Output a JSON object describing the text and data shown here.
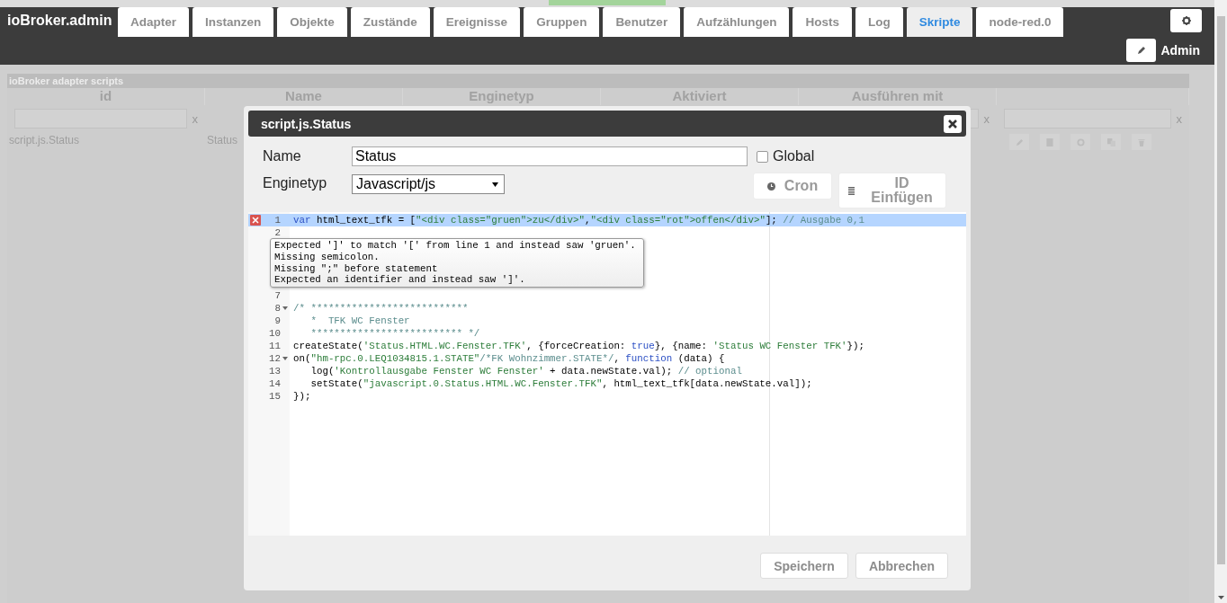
{
  "header": {
    "logo": "ioBroker.admin",
    "tabs": [
      {
        "label": "Adapter",
        "selected": false
      },
      {
        "label": "Instanzen",
        "selected": false
      },
      {
        "label": "Objekte",
        "selected": false
      },
      {
        "label": "Zustände",
        "selected": false
      },
      {
        "label": "Ereignisse",
        "selected": false
      },
      {
        "label": "Gruppen",
        "selected": false
      },
      {
        "label": "Benutzer",
        "selected": false
      },
      {
        "label": "Aufzählungen",
        "selected": false
      },
      {
        "label": "Hosts",
        "selected": false
      },
      {
        "label": "Log",
        "selected": false
      },
      {
        "label": "Skripte",
        "selected": true
      },
      {
        "label": "node-red.0",
        "selected": false
      }
    ],
    "user": "Admin"
  },
  "scripts_table": {
    "title": "ioBroker adapter scripts",
    "columns": [
      {
        "label": "id",
        "filter_clear": "x"
      },
      {
        "label": "Name"
      },
      {
        "label": "Enginetyp"
      },
      {
        "label": "Aktiviert"
      },
      {
        "label": "Ausführen mit",
        "filter_clear": "x"
      },
      {
        "filter_clear": "x"
      }
    ],
    "rows": [
      {
        "id": "script.js.Status",
        "name": "Status"
      }
    ]
  },
  "dialog": {
    "title": "script.js.Status",
    "name_label": "Name",
    "name_value": "Status",
    "global_label": "Global",
    "global_checked": false,
    "engine_label": "Enginetyp",
    "engine_value": "Javascript/js",
    "cron_button": "Cron",
    "id_button": "ID Einfügen",
    "editor": {
      "lines": [
        {
          "kind": "code",
          "num": "1",
          "error": true,
          "selected": true,
          "tokens": [
            {
              "kind": "kw",
              "s": "var"
            },
            {
              "kind": "plain",
              "s": " html_text_tfk = ["
            },
            {
              "kind": "str",
              "s": "\"<div class=\"gruen\">zu</div>\""
            },
            {
              "kind": "plain",
              "s": ","
            },
            {
              "kind": "str",
              "s": "\"<div class=\"rot\">offen</div>\""
            },
            {
              "kind": "plain",
              "s": "]; "
            },
            {
              "kind": "comment",
              "s": "// Ausgabe 0,1"
            }
          ]
        },
        {
          "kind": "code",
          "num": "2",
          "error": false,
          "selected": false
        },
        {
          "kind": "covered"
        },
        {
          "kind": "covered"
        },
        {
          "kind": "covered"
        },
        {
          "kind": "covered"
        },
        {
          "kind": "code",
          "num": "7",
          "error": false,
          "selected": false
        },
        {
          "kind": "code",
          "num": "8",
          "fold": true,
          "error": false,
          "selected": false,
          "tokens": [
            {
              "kind": "comment",
              "s": "/* ***************************"
            }
          ]
        },
        {
          "kind": "code",
          "num": "9",
          "error": false,
          "selected": false,
          "tokens": [
            {
              "kind": "comment",
              "s": "   *  TFK WC Fenster"
            }
          ]
        },
        {
          "kind": "code",
          "num": "10",
          "error": false,
          "selected": false,
          "tokens": [
            {
              "kind": "comment",
              "s": "   ************************** */"
            }
          ]
        },
        {
          "kind": "code",
          "num": "11",
          "error": false,
          "selected": false,
          "tokens": [
            {
              "kind": "plain",
              "s": "createState("
            },
            {
              "kind": "str",
              "s": "'Status.HTML.WC.Fenster.TFK'"
            },
            {
              "kind": "plain",
              "s": ", {forceCreation: "
            },
            {
              "kind": "kw",
              "s": "true"
            },
            {
              "kind": "plain",
              "s": "}, {name: "
            },
            {
              "kind": "str",
              "s": "'Status WC Fenster TFK'"
            },
            {
              "kind": "plain",
              "s": "});"
            }
          ]
        },
        {
          "kind": "code",
          "num": "12",
          "fold": true,
          "error": false,
          "selected": false,
          "tokens": [
            {
              "kind": "plain",
              "s": "on("
            },
            {
              "kind": "str",
              "s": "\"hm-rpc.0.LEQ1034815.1.STATE\""
            },
            {
              "kind": "comment",
              "s": "/*FK Wohnzimmer.STATE*/"
            },
            {
              "kind": "plain",
              "s": ", "
            },
            {
              "kind": "kw",
              "s": "function"
            },
            {
              "kind": "plain",
              "s": " (data) {"
            }
          ]
        },
        {
          "kind": "code",
          "num": "13",
          "error": false,
          "selected": false,
          "tokens": [
            {
              "kind": "plain",
              "s": "   log("
            },
            {
              "kind": "str",
              "s": "'Kontrollausgabe Fenster WC Fenster'"
            },
            {
              "kind": "plain",
              "s": " + data.newState.val); "
            },
            {
              "kind": "comment",
              "s": "// optional"
            }
          ]
        },
        {
          "kind": "code",
          "num": "14",
          "error": false,
          "selected": false,
          "tokens": [
            {
              "kind": "plain",
              "s": "   setState("
            },
            {
              "kind": "str",
              "s": "\"javascript.0.Status.HTML.WC.Fenster.TFK\""
            },
            {
              "kind": "plain",
              "s": ", html_text_tfk[data.newState.val]);"
            }
          ]
        },
        {
          "kind": "code",
          "num": "15",
          "error": false,
          "selected": false,
          "tokens": [
            {
              "kind": "plain",
              "s": "});"
            }
          ]
        }
      ],
      "tooltip": [
        "Expected ']' to match '[' from line 1 and instead saw 'gruen'.",
        "Missing semicolon.",
        "Missing \";\" before statement",
        "Expected an identifier and instead saw ']'."
      ]
    },
    "buttons": [
      {
        "label": "Speichern"
      },
      {
        "label": "Abbrechen"
      }
    ]
  }
}
